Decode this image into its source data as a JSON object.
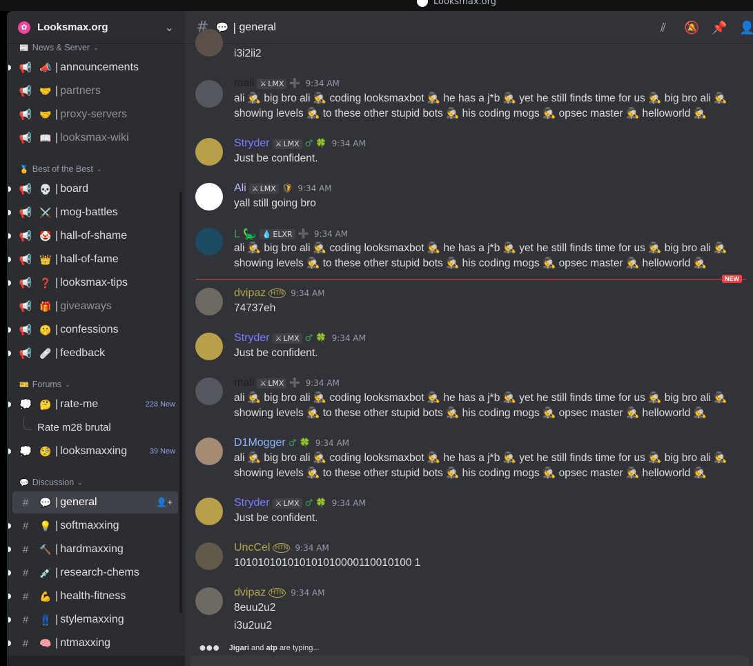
{
  "window": {
    "title": "Looksmax.org"
  },
  "guild": {
    "name": "Looksmax.org"
  },
  "categories": [
    {
      "label": "News & Server",
      "icon": "📰"
    },
    {
      "label": "Best of the Best",
      "icon": "🥇"
    },
    {
      "label": "Forums",
      "icon": "🎫"
    },
    {
      "label": "Discussion",
      "icon": "💬"
    }
  ],
  "channels": [
    {
      "name": "announcements",
      "emoji": "📣",
      "type": "📢"
    },
    {
      "name": "partners",
      "emoji": "🤝",
      "type": "📢"
    },
    {
      "name": "proxy-servers",
      "emoji": "🤝",
      "type": "📢"
    },
    {
      "name": "looksmax-wiki",
      "emoji": "📖",
      "type": "📢"
    },
    {
      "name": "board",
      "emoji": "💀",
      "type": "📢"
    },
    {
      "name": "mog-battles",
      "emoji": "⚔️",
      "type": "📢"
    },
    {
      "name": "hall-of-shame",
      "emoji": "🤡",
      "type": "📢"
    },
    {
      "name": "hall-of-fame",
      "emoji": "👑",
      "type": "📢"
    },
    {
      "name": "looksmax-tips",
      "emoji": "❓",
      "type": "📢"
    },
    {
      "name": "giveaways",
      "emoji": "🎁",
      "type": "📢"
    },
    {
      "name": "confessions",
      "emoji": "🤫",
      "type": "📢"
    },
    {
      "name": "feedback",
      "emoji": "🩹",
      "type": "📢"
    },
    {
      "name": "rate-me",
      "emoji": "🤔",
      "type": "💭",
      "badge": "228 New"
    },
    {
      "name": "looksmaxxing",
      "emoji": "🧐",
      "type": "💭",
      "badge": "39 New"
    },
    {
      "name": "general",
      "emoji": "💬",
      "type": "#"
    },
    {
      "name": "softmaxxing",
      "emoji": "💡",
      "type": "#"
    },
    {
      "name": "hardmaxxing",
      "emoji": "🔨",
      "type": "#"
    },
    {
      "name": "research-chems",
      "emoji": "💉",
      "type": "#"
    },
    {
      "name": "health-fitness",
      "emoji": "💪",
      "type": "#"
    },
    {
      "name": "stylemaxxing",
      "emoji": "👖",
      "type": "#"
    },
    {
      "name": "ntmaxxing",
      "emoji": "🧠",
      "type": "#"
    }
  ],
  "thread": {
    "name": "Rate m28 brutal"
  },
  "header": {
    "hash": "#",
    "emoji": "💬",
    "title": "general"
  },
  "common_text": {
    "ali": "ali 🕵 big bro ali 🕵 coding looksmaxbot 🕵 he has a j*b 🕵 yet he still finds time for us 🕵 big bro ali 🕵 showing levels 🕵 to these other stupid bots 🕵 his coding mogs 🕵 opsec master 🕵 helloworld 🕵",
    "confident": "Just be confident."
  },
  "messages": [
    {
      "author": "",
      "time": "",
      "text": "i3i2ii2",
      "color": "#dbdee1"
    },
    {
      "author": "mali",
      "tag": "LMX",
      "role": "➕",
      "time": "9:34 AM",
      "text": "ali 🕵 big bro ali 🕵 coding looksmaxbot 🕵 he has a j*b 🕵 yet he still finds time for us 🕵 big bro ali 🕵 showing levels 🕵 to these other stupid bots 🕵 his coding mogs 🕵 opsec master 🕵 helloworld 🕵",
      "color": "#1e1f22"
    },
    {
      "author": "Stryder",
      "tag": "LMX",
      "role": "♂ 🍀",
      "time": "9:34 AM",
      "text": "Just be confident.",
      "color": "#7b7dff"
    },
    {
      "author": "Ali",
      "tag": "LMX",
      "role": "🛡",
      "time": "9:34 AM",
      "text": "yall still going bro",
      "color": "#b8b9ff"
    },
    {
      "author": "L 🦕",
      "tag": "ELXR",
      "role": "➕",
      "time": "9:34 AM",
      "text": "ali 🕵 big bro ali 🕵 coding looksmaxbot 🕵 he has a j*b 🕵 yet he still finds time for us 🕵 big bro ali 🕵 showing levels 🕵 to these other stupid bots 🕵 his coding mogs 🕵 opsec master 🕵 helloworld 🕵",
      "color": "#3ba55c"
    },
    {
      "author": "dvipaz",
      "tag": "",
      "role": "HTN",
      "time": "9:34 AM",
      "text": "74737eh",
      "color": "#b5a642"
    },
    {
      "author": "Stryder",
      "tag": "LMX",
      "role": "♂ 🍀",
      "time": "9:34 AM",
      "text": "Just be confident.",
      "color": "#7b7dff"
    },
    {
      "author": "mali",
      "tag": "LMX",
      "role": "➕",
      "time": "9:34 AM",
      "text": "ali 🕵 big bro ali 🕵 coding looksmaxbot 🕵 he has a j*b 🕵 yet he still finds time for us 🕵 big bro ali 🕵 showing levels 🕵 to these other stupid bots 🕵 his coding mogs 🕵 opsec master 🕵 helloworld 🕵",
      "color": "#1e1f22"
    },
    {
      "author": "D1Mogger",
      "tag": "",
      "role": "♂ 🍀",
      "time": "9:34 AM",
      "text": "ali 🕵 big bro ali 🕵 coding looksmaxbot 🕵 he has a j*b 🕵 yet he still finds time for us 🕵 big bro ali 🕵 showing levels 🕵 to these other stupid bots 🕵 his coding mogs 🕵 opsec master 🕵 helloworld 🕵",
      "color": "#8ab4f8"
    },
    {
      "author": "Stryder",
      "tag": "LMX",
      "role": "♂ 🍀",
      "time": "9:34 AM",
      "text": "Just be confident.",
      "color": "#7b7dff"
    },
    {
      "author": "UncCel",
      "tag": "",
      "role": "HTN",
      "time": "9:34 AM",
      "text": "101010101010101010000110010100 1",
      "color": "#b5a642"
    },
    {
      "author": "dvipaz",
      "tag": "",
      "role": "HTN",
      "time": "9:34 AM",
      "text": "8euu2u2",
      "color": "#b5a642"
    }
  ],
  "followup": {
    "text": "i3u2uu2"
  },
  "new_marker": {
    "label": "NEW"
  },
  "typing": {
    "user1": "Jigari",
    "mid": " and ",
    "user2": "atp",
    "tail": " are typing..."
  }
}
